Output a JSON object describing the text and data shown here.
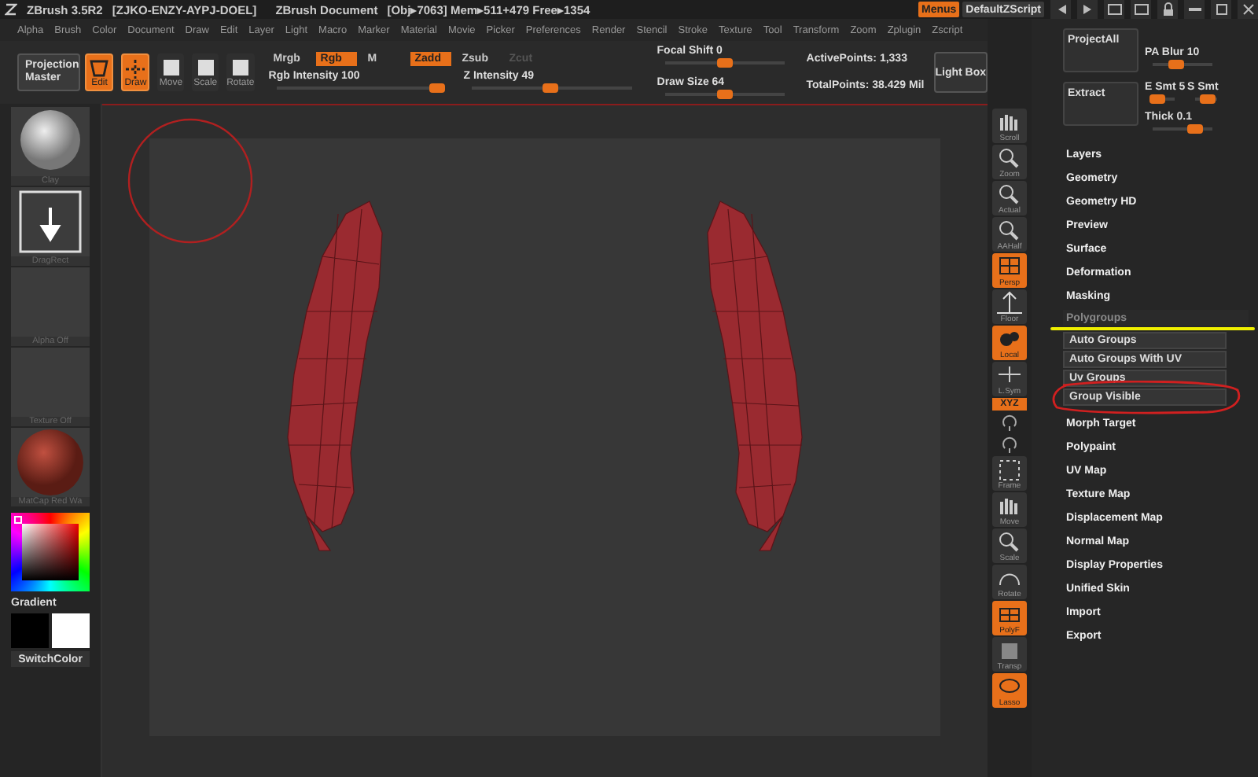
{
  "title_bar": {
    "app": "ZBrush 3.5R2",
    "key": "[ZJKO-ENZY-AYPJ-DOEL]",
    "document": "ZBrush Document",
    "stats": "[Obj▸7063] Mem▸511+479 Free▸1354"
  },
  "title_buttons": [
    {
      "label": "Menus",
      "selected": true
    },
    {
      "label": "DefaultZScript",
      "selected": false
    }
  ],
  "menu_bar": [
    "Alpha",
    "Brush",
    "Color",
    "Document",
    "Draw",
    "Edit",
    "Layer",
    "Light",
    "Macro",
    "Marker",
    "Material",
    "Movie",
    "Picker",
    "Preferences",
    "Render",
    "Stencil",
    "Stroke",
    "Texture",
    "Tool",
    "Transform",
    "Zoom",
    "Zplugin",
    "Zscript"
  ],
  "toolbar": {
    "projection_master": "Projection Master",
    "tools": [
      {
        "label": "Edit",
        "on": true
      },
      {
        "label": "Draw",
        "on": true
      },
      {
        "label": "Move",
        "on": false
      },
      {
        "label": "Scale",
        "on": false
      },
      {
        "label": "Rotate",
        "on": false
      }
    ],
    "modes": [
      {
        "label": "Mrgb",
        "on": false,
        "disabled": false
      },
      {
        "label": "Rgb",
        "on": true,
        "disabled": false
      },
      {
        "label": "M",
        "on": false,
        "disabled": false
      },
      {
        "label": "Zadd",
        "on": true,
        "disabled": false
      },
      {
        "label": "Zsub",
        "on": false,
        "disabled": false
      },
      {
        "label": "Zcut",
        "on": false,
        "disabled": true
      }
    ],
    "sliders": [
      {
        "label": "Rgb Intensity",
        "reading": "100",
        "level": 1
      },
      {
        "label": "Z Intensity",
        "reading": "49",
        "level": 0.49
      },
      {
        "label": "Focal Shift",
        "reading": "0",
        "level": 0.5
      },
      {
        "label": "Draw Size",
        "reading": "64",
        "level": 0.5
      }
    ],
    "stats": [
      "ActivePoints: 1,333",
      "TotalPoints: 38.429 Mil"
    ],
    "light_box": "Light Box"
  },
  "left_shelf": [
    {
      "kind": "sphere",
      "label": "Clay"
    },
    {
      "kind": "stroke",
      "label": "DragRect"
    },
    {
      "kind": "empty",
      "label": "Alpha Off"
    },
    {
      "kind": "empty",
      "label": "Texture Off"
    },
    {
      "kind": "material",
      "label": "MatCap Red Wa"
    }
  ],
  "color_picker": {
    "gradient": "Gradient",
    "switch_color": "SwitchColor"
  },
  "right_shelf": [
    {
      "kind": "tool",
      "label": "Scroll",
      "on": false
    },
    {
      "kind": "tool",
      "label": "Zoom",
      "on": false
    },
    {
      "kind": "tool",
      "label": "Actual",
      "on": false
    },
    {
      "kind": "tool",
      "label": "AAHalf",
      "on": false
    },
    {
      "kind": "tool",
      "label": "Persp",
      "on": true
    },
    {
      "kind": "tool",
      "label": "Floor",
      "on": false
    },
    {
      "kind": "tool",
      "label": "Local",
      "on": true
    },
    {
      "kind": "tool",
      "label": "L.Sym",
      "on": false
    },
    {
      "kind": "pill",
      "label": "XYZ",
      "on": true
    },
    {
      "kind": "icon",
      "on": false
    },
    {
      "kind": "icon",
      "on": false
    },
    {
      "kind": "tool",
      "label": "Frame",
      "on": false
    },
    {
      "kind": "tool",
      "label": "Move",
      "on": false
    },
    {
      "kind": "tool",
      "label": "Scale",
      "on": false
    },
    {
      "kind": "tool",
      "label": "Rotate",
      "on": false
    },
    {
      "kind": "tool",
      "label": "PolyF",
      "on": true
    },
    {
      "kind": "tool",
      "label": "Transp",
      "on": false
    },
    {
      "kind": "tool",
      "label": "Lasso",
      "on": true
    }
  ],
  "subtool_panel": {
    "buttons": [
      "ProjectAll",
      "Extract"
    ],
    "sliders": [
      {
        "label": "PA Blur 10",
        "level": 0.4
      },
      {
        "label": "E Smt 5",
        "level": 0.2
      },
      {
        "label": "S Smt",
        "level": 0.6
      },
      {
        "label": "Thick 0.1",
        "level": 0.7
      }
    ]
  },
  "palette": [
    {
      "label": "Layers"
    },
    {
      "label": "Geometry"
    },
    {
      "label": "Geometry HD"
    },
    {
      "label": "Preview"
    },
    {
      "label": "Surface"
    },
    {
      "label": "Deformation"
    },
    {
      "label": "Masking"
    },
    {
      "label": "Polygroups",
      "children": [
        "Auto Groups",
        "Auto Groups With UV",
        "Uv Groups",
        "Group Visible"
      ]
    },
    {
      "label": "Morph Target"
    },
    {
      "label": "Polypaint"
    },
    {
      "label": "UV Map"
    },
    {
      "label": "Texture Map"
    },
    {
      "label": "Displacement Map"
    },
    {
      "label": "Normal Map"
    },
    {
      "label": "Display Properties"
    },
    {
      "label": "Unified Skin"
    },
    {
      "label": "Import"
    },
    {
      "label": "Export"
    }
  ]
}
